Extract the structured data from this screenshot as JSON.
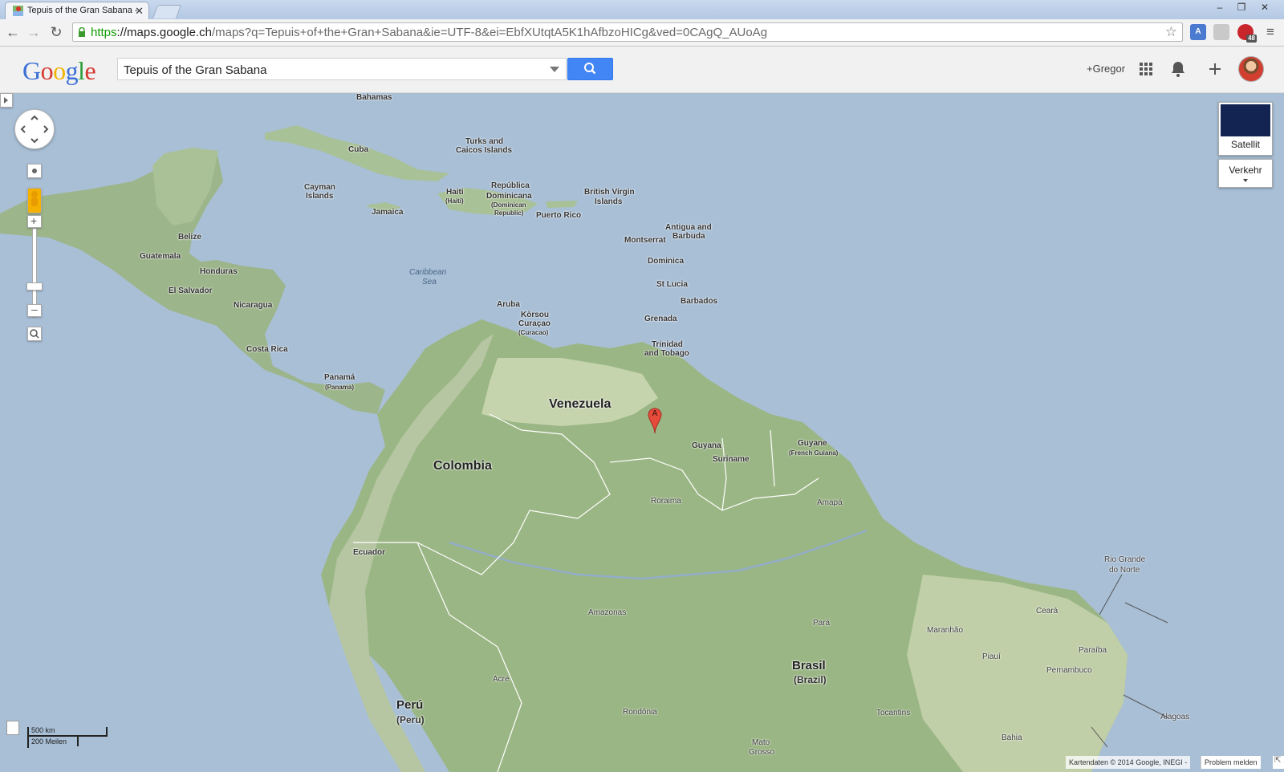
{
  "browser": {
    "tab_title": "Tepuis of the Gran Sabana -",
    "url_scheme": "https",
    "url_host": "://maps.google.ch",
    "url_path": "/maps?q=Tepuis+of+the+Gran+Sabana&ie=UTF-8&ei=EbfXUtqtA5K1hAfbzoHICg&ved=0CAgQ_AUoAg",
    "ext_badge": "48"
  },
  "header": {
    "logo": "Google",
    "search_value": "Tepuis of the Gran Sabana",
    "user_link": "+Gregor"
  },
  "map": {
    "satellite_label": "Satellit",
    "traffic_label": "Verkehr",
    "scale_km": "500 km",
    "scale_mi": "200 Meilen",
    "footer_text": "Kartendaten © 2014 Google, INEGI -",
    "report_label": "Problem melden",
    "marker_letter": "A",
    "labels": {
      "bahamas": "Bahamas",
      "turks1": "Turks and",
      "turks2": "Caicos Islands",
      "cuba": "Cuba",
      "cayman1": "Cayman",
      "cayman2": "Islands",
      "haiti1": "Haiti",
      "haiti2": "(Haiti)",
      "domrep1": "República",
      "domrep2": "Dominicana",
      "domrep3": "(Dominican",
      "domrep4": "Republic)",
      "bvi1": "British Virgin",
      "bvi2": "Islands",
      "jamaica": "Jamaica",
      "puertorico": "Puerto Rico",
      "antigua1": "Antigua and",
      "antigua2": "Barbuda",
      "montserrat": "Montserrat",
      "dominica": "Dominica",
      "stlucia": "St Lucia",
      "barbados": "Barbados",
      "grenada": "Grenada",
      "trinidad1": "Trinidad",
      "trinidad2": "and Tobago",
      "belize": "Belize",
      "guatemala": "Guatemala",
      "honduras": "Honduras",
      "elsalvador": "El Salvador",
      "nicaragua": "Nicaragua",
      "costarica": "Costa Rica",
      "panama1": "Panamá",
      "panama2": "(Panama)",
      "caribbean1": "Caribbean",
      "caribbean2": "Sea",
      "aruba": "Aruba",
      "curacao1": "Kòrsou",
      "curacao2": "Curaçao",
      "curacao3": "(Curacao)",
      "venezuela": "Venezuela",
      "colombia": "Colombia",
      "guyana": "Guyana",
      "suriname": "Suriname",
      "guyane1": "Guyane",
      "guyane2": "(French Guiana)",
      "roraima": "Roraima",
      "amapa": "Amapá",
      "ecuador": "Ecuador",
      "riogrande1": "Rio Grande",
      "riogrande2": "do Norte",
      "amazonas": "Amazonas",
      "para": "Pará",
      "ceara": "Ceará",
      "maranhao": "Maranhão",
      "paraiba": "Paraíba",
      "piaui": "Piauí",
      "pernambuco": "Pernambuco",
      "brasil1": "Brasil",
      "brasil2": "(Brazil)",
      "acre": "Acre",
      "peru1": "Perú",
      "peru2": "(Peru)",
      "tocantins": "Tocantins",
      "alagoas": "Alagoas",
      "rondonia": "Rondônia",
      "bahia": "Bahia",
      "matogrosso1": "Mato",
      "matogrosso2": "Grosso"
    }
  }
}
